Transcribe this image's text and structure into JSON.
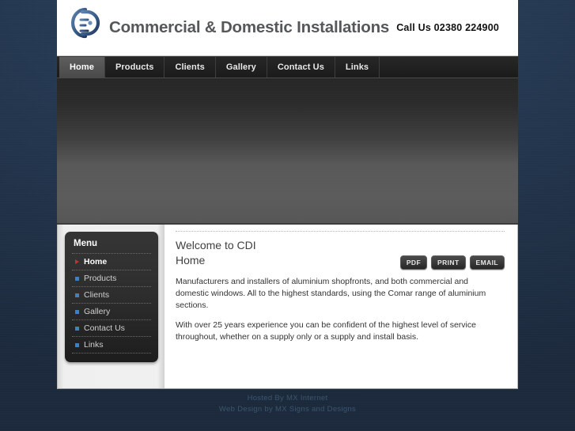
{
  "header": {
    "logo_icon": "cdi-monogram-logo",
    "brand_name": "Commercial & Domestic Installations",
    "call_us": "Call Us 02380 224900"
  },
  "nav": {
    "items": [
      {
        "label": "Home",
        "active": true
      },
      {
        "label": "Products",
        "active": false
      },
      {
        "label": "Clients",
        "active": false
      },
      {
        "label": "Gallery",
        "active": false
      },
      {
        "label": "Contact Us",
        "active": false
      },
      {
        "label": "Links",
        "active": false
      }
    ]
  },
  "banner": {
    "alt": "header-banner-image"
  },
  "sidebar": {
    "title": "Menu",
    "items": [
      {
        "label": "Home",
        "current": true,
        "bullet": "arrow-bullet-icon"
      },
      {
        "label": "Products",
        "current": false,
        "bullet": "square-bullet-icon"
      },
      {
        "label": "Clients",
        "current": false,
        "bullet": "square-bullet-icon"
      },
      {
        "label": "Gallery",
        "current": false,
        "bullet": "square-bullet-icon"
      },
      {
        "label": "Contact Us",
        "current": false,
        "bullet": "square-bullet-icon"
      },
      {
        "label": "Links",
        "current": false,
        "bullet": "square-bullet-icon"
      }
    ]
  },
  "main": {
    "page_heading": "Welcome to CDI",
    "article_title": "Home",
    "tools": [
      {
        "label": "PDF",
        "icon": "pdf-icon"
      },
      {
        "label": "PRINT",
        "icon": "print-icon"
      },
      {
        "label": "EMAIL",
        "icon": "email-icon"
      }
    ],
    "paragraphs": [
      "Manufacturers and installers of aluminium shopfronts, and both commercial and domestic windows. All to the highest standards, using the Comar range of aluminium sections.",
      "With over 25 years experience you can be confident of the highest level of service throughout, whether on a supply only or a supply and install basis."
    ]
  },
  "footer": {
    "hosted_by": "Hosted By MX Internet",
    "web_design": "Web Design by MX Signs and Designs"
  },
  "colors": {
    "page_background": "#24374f",
    "logo_blue": "#3a5e8c",
    "accent_red": "#c33131",
    "accent_blue": "#3f7fc4",
    "nav_background": "#1e1e1e",
    "footer_text": "#3b556f"
  }
}
